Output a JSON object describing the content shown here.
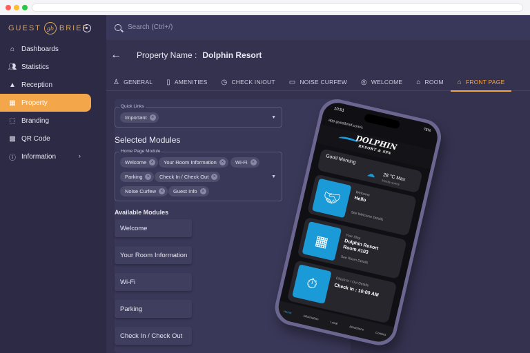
{
  "sidebar": {
    "logo_left": "GUEST",
    "logo_mark": "gb",
    "logo_right": "BRIEF",
    "items": [
      {
        "label": "Dashboards",
        "icon": "home-icon"
      },
      {
        "label": "Statistics",
        "icon": "users-icon"
      },
      {
        "label": "Reception",
        "icon": "bell-icon"
      },
      {
        "label": "Property",
        "icon": "building-icon",
        "active": true
      },
      {
        "label": "Branding",
        "icon": "branding-icon"
      },
      {
        "label": "QR Code",
        "icon": "qr-icon"
      },
      {
        "label": "Information",
        "icon": "info-icon",
        "has_submenu": true
      }
    ]
  },
  "search": {
    "placeholder": "Search (Ctrl+/)"
  },
  "header": {
    "property_label": "Property Name :",
    "property_name": "Dolphin Resort"
  },
  "tabs": [
    {
      "label": "GENERAL"
    },
    {
      "label": "AMENITIES"
    },
    {
      "label": "CHECK IN/OUT"
    },
    {
      "label": "NOISE CURFEW"
    },
    {
      "label": "WELCOME"
    },
    {
      "label": "ROOM"
    },
    {
      "label": "FRONT PAGE",
      "active": true
    }
  ],
  "quick_links": {
    "label": "Quick Links",
    "chips": [
      "Important"
    ]
  },
  "selected_modules": {
    "title": "Selected Modules",
    "field_label": "Home Page Module",
    "chips": [
      "Welcome",
      "Your Room Information",
      "Wi-Fi",
      "Parking",
      "Check In / Check Out",
      "Noise Curfew",
      "Guest Info"
    ]
  },
  "available_modules": {
    "title": "Available Modules",
    "items": [
      "Welcome",
      "Your Room Information",
      "Wi-Fi",
      "Parking",
      "Check In / Check Out"
    ]
  },
  "phone": {
    "time": "10:51",
    "battery": "75%",
    "url": "app.guestbrief.com/c",
    "brand": "DOLPHIN",
    "brand_sub": "RESORT & SPA",
    "greeting": "Good Morning",
    "temp": "28 °C Max",
    "weather_sub": "Mostly sunny",
    "card1_small": "Welcome",
    "card1_big": "Hello",
    "card1_link": "See Welcome Details",
    "card2_small": "Your Stay",
    "card2_big": "Dolphin Resort",
    "card2_room": "Room #103",
    "card2_link": "See Room Details",
    "card3_small": "Check In / Out Details",
    "card3_big": "Check In : 10:00 AM",
    "nav": [
      "Home",
      "Information",
      "Local",
      "Attractions",
      "Contact"
    ]
  },
  "colors": {
    "accent": "#f4a64a",
    "sidebar_bg": "#2c2a45",
    "main_bg": "#34324f",
    "phone_blue": "#1b9ad8"
  }
}
